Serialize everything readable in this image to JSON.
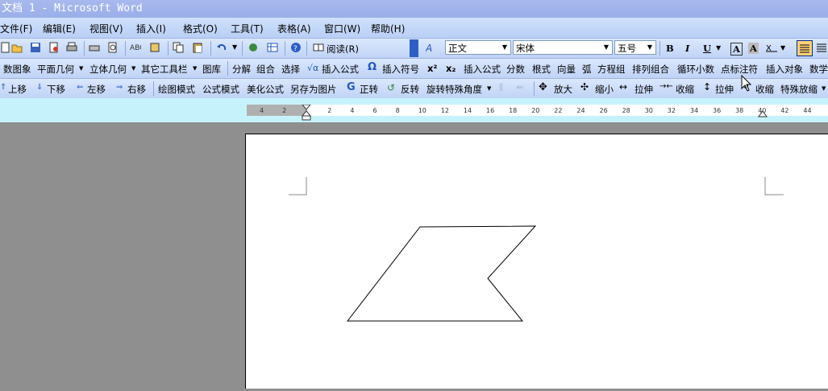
{
  "title": "文档 1 - Microsoft Word",
  "menu": [
    "文件(F)",
    "编辑(E)",
    "视图(V)",
    "插入(I)",
    "格式(O)",
    "工具(T)",
    "表格(A)",
    "窗口(W)",
    "帮助(H)"
  ],
  "std_toolbar": {
    "reading_label": "阅读(R)",
    "style_value": "正文",
    "font_value": "宋体",
    "size_value": "五号",
    "bold": "B",
    "italic": "I",
    "underline": "U",
    "fontcolor": "A"
  },
  "math_toolbar1": [
    "数图象",
    "平面几何",
    "立体几何",
    "其它工具栏",
    "图库",
    "分解",
    "组合",
    "选择",
    "插入公式",
    "插入符号",
    "x²",
    "x₂",
    "插入公式",
    "分数",
    "根式",
    "向量",
    "弧",
    "方程组",
    "排列组合",
    "循环小数",
    "点标注符",
    "插入对象",
    "数学"
  ],
  "math_toolbar2": [
    "上移",
    "下移",
    "左移",
    "右移",
    "绘图模式",
    "公式模式",
    "美化公式",
    "另存为图片",
    "正转",
    "反转",
    "旋转特殊角度",
    "放大",
    "缩小",
    "拉伸",
    "收缩",
    "拉伸",
    "收缩",
    "特殊放缩"
  ],
  "ruler_ticks": [
    "4",
    "2",
    "",
    "2",
    "4",
    "6",
    "8",
    "10",
    "12",
    "14",
    "16",
    "18",
    "20",
    "22",
    "24",
    "26",
    "28",
    "30",
    "32",
    "34",
    "36",
    "38",
    "40",
    "42",
    "44"
  ],
  "colors": {
    "title_bg": "#9aaee8",
    "toolbar_bg": "#c7d9f8",
    "ruler_band": "#c6f3fb",
    "workspace": "#8f8f8f"
  }
}
